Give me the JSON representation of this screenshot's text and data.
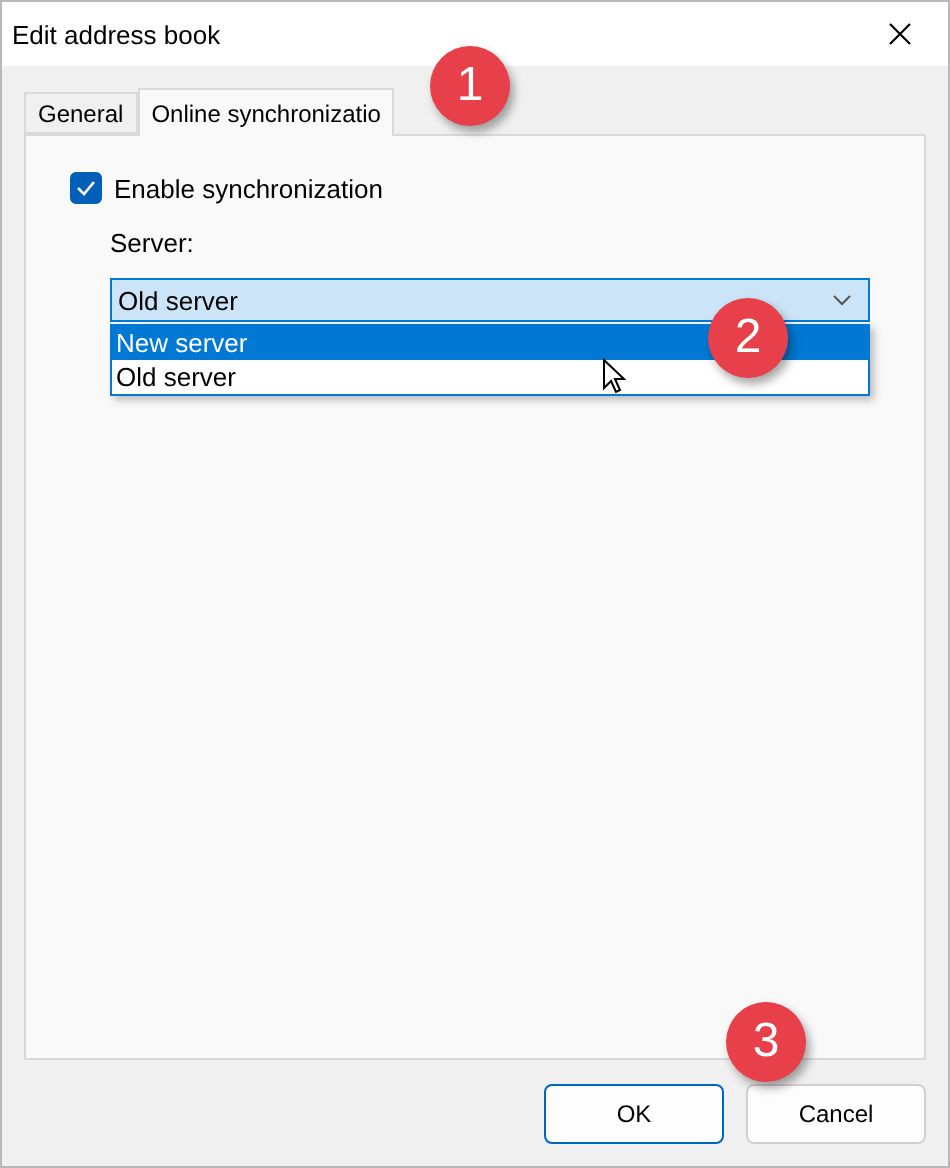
{
  "window": {
    "title": "Edit address book"
  },
  "tabs": [
    {
      "label": "General",
      "selected": false
    },
    {
      "label": "Online synchronizatio",
      "selected": true
    }
  ],
  "sync": {
    "label": "Enable synchronization",
    "checked": true
  },
  "server": {
    "label": "Server:",
    "value": "Old server",
    "open": true,
    "options": [
      {
        "label": "New server",
        "highlighted": true
      },
      {
        "label": "Old server",
        "highlighted": false
      }
    ]
  },
  "buttons": [
    {
      "label": "OK",
      "default": true
    },
    {
      "label": "Cancel",
      "default": false
    }
  ],
  "callouts": [
    "1",
    "2",
    "3"
  ]
}
